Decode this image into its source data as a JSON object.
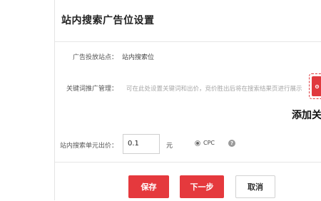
{
  "dialog": {
    "title": "站内搜索广告位设置"
  },
  "form": {
    "placement_label": "广告投放站点：",
    "placement_value": "站内搜索位",
    "keyword_label": "关键词推广管理：",
    "keyword_hint": "可在此处设置关键词和出价，竞价胜出后将在搜索结果页进行展示",
    "add_button_caption": "添加关",
    "price_label": "站内搜索单元出价：",
    "price_value": "0.1",
    "price_unit": "元",
    "bid_mode": "CPC",
    "help_icon": "?"
  },
  "footer": {
    "save_label": "保存",
    "next_label": "下一步",
    "cancel_label": "取消"
  },
  "colors": {
    "accent": "#e5393d",
    "border": "#e6e6e6"
  },
  "icons": {
    "add_keyword": "gear-icon",
    "help": "question-icon"
  }
}
